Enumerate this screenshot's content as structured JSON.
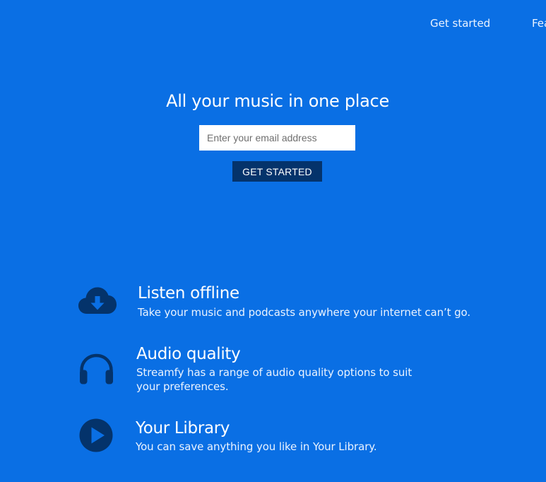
{
  "nav": {
    "links": [
      {
        "label": "Get started"
      },
      {
        "label": "Features"
      }
    ]
  },
  "hero": {
    "title": "All your music in one place",
    "email_placeholder": "Enter your email address",
    "cta_label": "GET STARTED"
  },
  "features": [
    {
      "icon": "cloud-download-icon",
      "title": "Listen offline",
      "description": "Take your music and podcasts anywhere your internet can’t go."
    },
    {
      "icon": "headphones-icon",
      "title": "Audio quality",
      "description": "Streamfy has a range of audio quality options to suit your preferences."
    },
    {
      "icon": "play-circle-icon",
      "title": "Your Library",
      "description": "You can save anything you like in Your Library."
    }
  ],
  "colors": {
    "background": "#0a6fe4",
    "button": "#04336b",
    "icon": "#04336b"
  }
}
